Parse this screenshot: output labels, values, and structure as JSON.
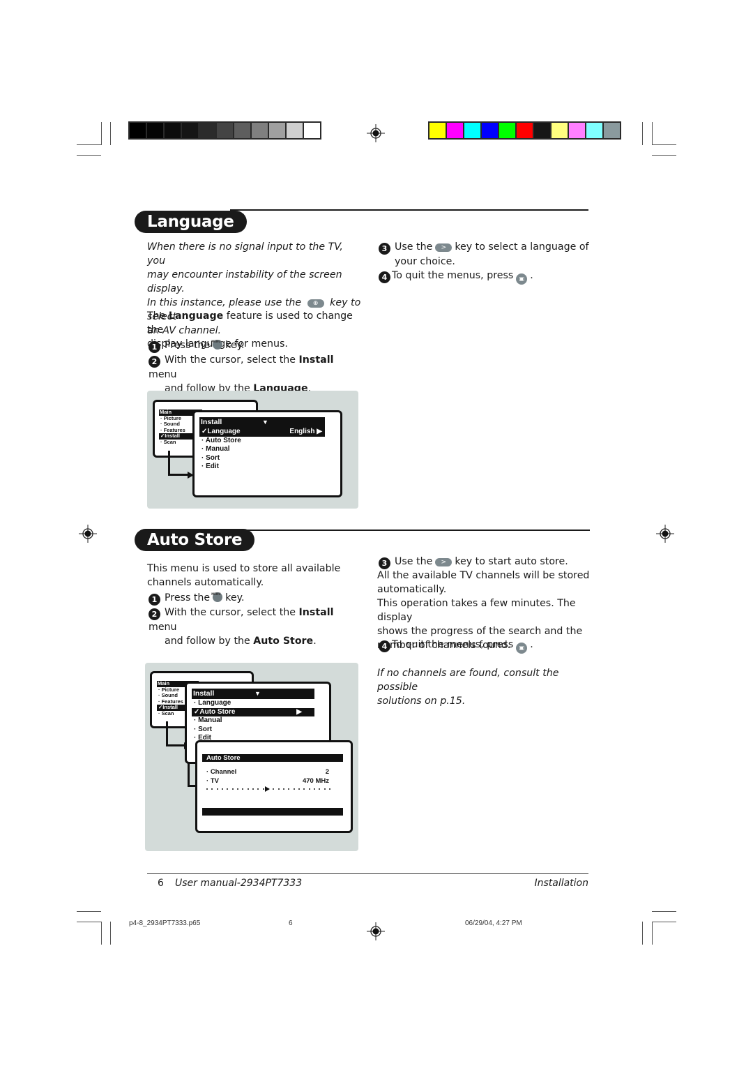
{
  "print_marks": {
    "gray_swatches": [
      "#000000",
      "#050505",
      "#0c0c0c",
      "#151515",
      "#2b2b2b",
      "#444444",
      "#5e5e5e",
      "#7f7f7f",
      "#a0a0a0",
      "#cfcfcf",
      "#ffffff"
    ],
    "color_swatches": [
      "#ffff00",
      "#ff00ff",
      "#00ffff",
      "#0000ff",
      "#00ff00",
      "#ff0000",
      "#161616",
      "#ffff80",
      "#ff80ff",
      "#80ffff",
      "#8a9a9e"
    ]
  },
  "language": {
    "title": "Language",
    "note_lines": [
      "When there is no signal input to the TV, you",
      "may encounter instability of the screen display.",
      "In this instance, please use the",
      "key to select",
      "an AV channel."
    ],
    "intro_pre": "The ",
    "intro_bold": "Language",
    "intro_post": " feature is used to change the",
    "intro_line2": "display language for menus.",
    "steps": [
      {
        "num": "1",
        "pre": "Press the",
        "post": "key."
      },
      {
        "num": "2",
        "pre": "With the cursor, select the ",
        "bold1": "Install",
        "mid": " menu",
        "line2_pre": "and follow by the ",
        "bold2": "Language",
        "line2_post": "."
      },
      {
        "num": "3",
        "pre": "Use the",
        "post": "key to select a language of",
        "line2": "your choice."
      },
      {
        "num": "4",
        "pre": "To quit the menus, press",
        "post": "."
      }
    ],
    "diagram": {
      "main_menu": {
        "header": "Main",
        "items": [
          "Picture",
          "Sound",
          "Features",
          "Install",
          "Scan"
        ],
        "selected": "Install"
      },
      "install_menu": {
        "header": "Install",
        "header_icon": "▼",
        "items": [
          {
            "label": "Language",
            "value": "English",
            "arrow": "▶",
            "selected": true
          },
          {
            "label": "Auto Store"
          },
          {
            "label": "Manual"
          },
          {
            "label": "Sort"
          },
          {
            "label": "Edit"
          }
        ]
      }
    }
  },
  "auto_store": {
    "title": "Auto Store",
    "intro_line1": "This menu is used to store all available",
    "intro_line2": "channels automatically.",
    "steps": [
      {
        "num": "1",
        "pre": "Press the",
        "post": "key."
      },
      {
        "num": "2",
        "pre": "With the cursor, select the ",
        "bold1": "Install",
        "mid": " menu",
        "line2_pre": "and follow by the ",
        "bold2": "Auto Store",
        "line2_post": "."
      },
      {
        "num": "3",
        "pre": "Use the",
        "post": "key to start auto store."
      },
      {
        "num": "4",
        "pre": "To quit the menus, press",
        "post": "."
      }
    ],
    "body_lines": [
      "All the available TV channels will be stored",
      "automatically.",
      "This operation takes a few minutes. The display",
      "shows the progress of the search and the",
      "number of channels found."
    ],
    "note_lines": [
      "If no channels are found, consult the possible",
      "solutions on p.15."
    ],
    "diagram": {
      "main_menu": {
        "header": "Main",
        "items": [
          "Picture",
          "Sound",
          "Features",
          "Install",
          "Scan"
        ],
        "selected": "Install"
      },
      "install_menu": {
        "header": "Install",
        "header_icon": "▼",
        "items": [
          {
            "label": "Language"
          },
          {
            "label": "Auto Store",
            "arrow": "▶",
            "selected": true
          },
          {
            "label": "Manual"
          },
          {
            "label": "Sort"
          },
          {
            "label": "Edit"
          }
        ]
      },
      "autostore_screen": {
        "header": "Auto Store",
        "rows": [
          {
            "label": "Channel",
            "value": "2"
          },
          {
            "label": "TV",
            "value": "470 MHz"
          }
        ],
        "progress_fraction": 0.5
      }
    }
  },
  "keys": {
    "menu_key_label": "MENU",
    "right_key_glyph": ">",
    "av_key_glyph": "⊕",
    "exit_key_glyph": "▣"
  },
  "footer": {
    "page_number": "6",
    "manual_title": "User manual-2934PT7333",
    "section": "Installation"
  },
  "slug": {
    "filename": "p4-8_2934PT7333.p65",
    "page": "6",
    "datetime": "06/29/04, 4:27 PM"
  }
}
